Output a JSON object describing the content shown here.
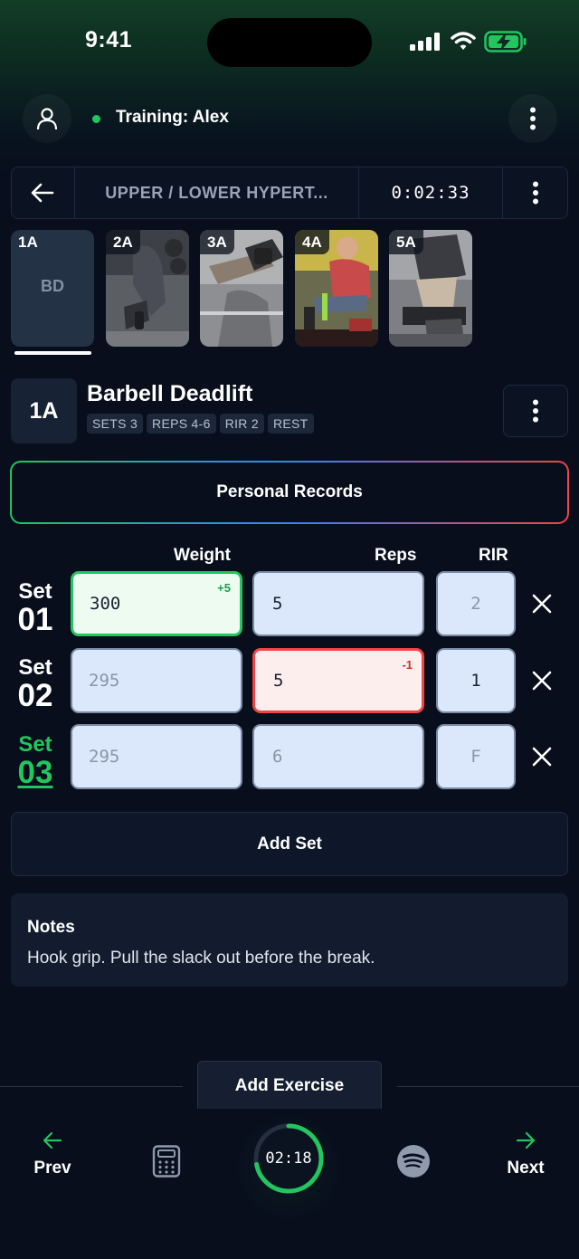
{
  "status_bar": {
    "time": "9:41"
  },
  "header": {
    "title": "Training: Alex"
  },
  "workout_bar": {
    "title": "UPPER / LOWER HYPERT...",
    "timer": "0:02:33"
  },
  "thumbnails": [
    {
      "label": "1A",
      "initials": "BD",
      "active": true
    },
    {
      "label": "2A",
      "active": false
    },
    {
      "label": "3A",
      "active": false
    },
    {
      "label": "4A",
      "active": false
    },
    {
      "label": "5A",
      "active": false
    }
  ],
  "exercise": {
    "badge": "1A",
    "name": "Barbell Deadlift",
    "tags": [
      "SETS 3",
      "REPS 4-6",
      "RIR 2",
      "REST"
    ]
  },
  "personal_records_label": "Personal Records",
  "columns": {
    "weight": "Weight",
    "reps": "Reps",
    "rir": "RIR"
  },
  "sets": [
    {
      "word": "Set",
      "number": "01",
      "weight": "300",
      "weight_delta": "+5",
      "reps": "5",
      "reps_delta": "",
      "rir": "2"
    },
    {
      "word": "Set",
      "number": "02",
      "weight": "295",
      "weight_delta": "",
      "reps": "5",
      "reps_delta": "-1",
      "rir": "1"
    },
    {
      "word": "Set",
      "number": "03",
      "weight": "295",
      "weight_delta": "",
      "reps": "6",
      "reps_delta": "",
      "rir": "F"
    }
  ],
  "add_set_label": "Add Set",
  "notes": {
    "title": "Notes",
    "body": "Hook grip. Pull the slack out before the break."
  },
  "add_exercise_label": "Add Exercise",
  "bottom_nav": {
    "prev": "Prev",
    "next": "Next",
    "rest_timer": "02:18",
    "rest_progress": 0.72
  },
  "colors": {
    "accent": "#22c55e",
    "danger": "#ef4444",
    "background": "#080e1c"
  }
}
